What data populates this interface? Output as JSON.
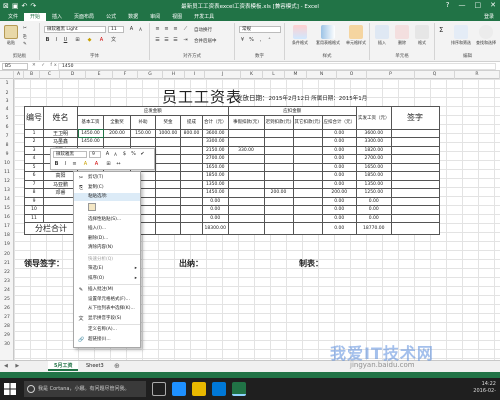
{
  "window": {
    "title": "最新员工工资表excel工资表模板.xls [兼容模式] - Excel",
    "controls": [
      "?",
      "—",
      "□",
      "✕"
    ]
  },
  "ribbon_tabs": [
    "文件",
    "开始",
    "插入",
    "页面布局",
    "公式",
    "数据",
    "审阅",
    "视图",
    "开发工具"
  ],
  "account": "登录",
  "ribbon": {
    "clipboard": {
      "label": "剪贴板",
      "paste": "粘贴",
      "cut": "✂",
      "copy": "⎘",
      "format_painter": "✎"
    },
    "font": {
      "label": "字体",
      "name": "微软雅黑 Light",
      "size": "11"
    },
    "alignment": {
      "label": "对齐方式",
      "wrap": "自动换行",
      "merge": "合并后居中"
    },
    "number": {
      "label": "数字",
      "format": "常规"
    },
    "styles": {
      "label": "样式",
      "conditional": "条件格式",
      "table": "套用表格格式",
      "cell_styles": "单元格样式"
    },
    "cells": {
      "label": "单元格",
      "insert": "插入",
      "delete": "删除",
      "format": "格式"
    },
    "editing": {
      "label": "编辑",
      "autosum": "Σ",
      "sort": "排序和筛选",
      "find": "查找和选择"
    }
  },
  "formula_bar": {
    "name_box": "B5",
    "fx": "✕ ✓ fx",
    "value": "1450"
  },
  "columns": [
    "A",
    "B",
    "C",
    "D",
    "E",
    "F",
    "G",
    "H",
    "I",
    "J",
    "K",
    "L",
    "M",
    "N",
    "O",
    "P",
    "Q",
    "R"
  ],
  "rows": [
    "1",
    "2",
    "3",
    "4",
    "5",
    "6",
    "7",
    "8",
    "9",
    "10",
    "11",
    "12",
    "13",
    "14",
    "15",
    "16",
    "17",
    "18",
    "19",
    "20",
    "21",
    "22",
    "23",
    "24",
    "25",
    "26",
    "27",
    "28",
    "29",
    "30"
  ],
  "sheet": {
    "title": "员工工资表",
    "issue_label": "发放日期：",
    "issue_value": "2015年2月12日  所属日期：2015年1月",
    "headers": {
      "no": "编号",
      "name": "姓名",
      "payable": "应发金额",
      "deduct": "应扣金额",
      "actual": "实发工资（元）",
      "sign": "签字",
      "sub_payable": [
        "基本工资",
        "全勤奖",
        "补助",
        "奖金",
        "提成",
        "合计（元）"
      ],
      "sub_deduct": [
        "事假扣款(元)",
        "迟到扣款(元)",
        "其它扣款(元)",
        "应扣合计（元）"
      ]
    },
    "rows": [
      {
        "no": "1",
        "name": "王卫明",
        "base": "1450.00",
        "attend": "200.00",
        "allow": "150.00",
        "bonus": "1000.00",
        "comm": "800.00",
        "total": "3600.00",
        "leave": "",
        "late": "",
        "other": "",
        "dtotal": "0.00",
        "net": "3600.00"
      },
      {
        "no": "2",
        "name": "马虽鑫",
        "base": "1450.00",
        "attend": "",
        "allow": "",
        "bonus": "",
        "comm": "",
        "total": "3300.00",
        "leave": "",
        "late": "",
        "other": "",
        "dtotal": "0.00",
        "net": "3300.00"
      },
      {
        "no": "3",
        "name": "郑国珣",
        "base": "",
        "attend": "",
        "allow": "",
        "bonus": "",
        "comm": "",
        "total": "2150.00",
        "leave": "330.00",
        "late": "",
        "other": "",
        "dtotal": "0.00",
        "net": "1820.00"
      },
      {
        "no": "4",
        "name": "马念佳",
        "base": "1450.00",
        "attend": "",
        "allow": "",
        "bonus": "",
        "comm": "",
        "total": "2700.00",
        "leave": "",
        "late": "",
        "other": "",
        "dtotal": "0.00",
        "net": "2700.00"
      },
      {
        "no": "5",
        "name": "张爱琴",
        "base": "",
        "attend": "",
        "allow": "",
        "bonus": "",
        "comm": "",
        "total": "1650.00",
        "leave": "",
        "late": "",
        "other": "",
        "dtotal": "0.00",
        "net": "1650.00"
      },
      {
        "no": "6",
        "name": "高阳",
        "base": "",
        "attend": "",
        "allow": "",
        "bonus": "",
        "comm": "",
        "total": "1850.00",
        "leave": "",
        "late": "",
        "other": "",
        "dtotal": "0.00",
        "net": "1850.00"
      },
      {
        "no": "7",
        "name": "马亚鹏",
        "base": "",
        "attend": "",
        "allow": "",
        "bonus": "",
        "comm": "",
        "total": "1350.00",
        "leave": "",
        "late": "",
        "other": "",
        "dtotal": "0.00",
        "net": "1350.00"
      },
      {
        "no": "8",
        "name": "邓睿",
        "base": "1450.00",
        "attend": "",
        "allow": "",
        "bonus": "",
        "comm": "",
        "total": "1450.00",
        "leave": "",
        "late": "200.00",
        "other": "",
        "dtotal": "200.00",
        "net": "1250.00"
      },
      {
        "no": "9",
        "name": "",
        "base": "",
        "attend": "",
        "allow": "",
        "bonus": "",
        "comm": "",
        "total": "0.00",
        "leave": "",
        "late": "",
        "other": "",
        "dtotal": "0.00",
        "net": "0.00"
      },
      {
        "no": "10",
        "name": "",
        "base": "",
        "attend": "",
        "allow": "",
        "bonus": "",
        "comm": "",
        "total": "0.00",
        "leave": "",
        "late": "",
        "other": "",
        "dtotal": "0.00",
        "net": "0.00"
      },
      {
        "no": "11",
        "name": "",
        "base": "",
        "attend": "",
        "allow": "",
        "bonus": "",
        "comm": "",
        "total": "0.00",
        "leave": "",
        "late": "",
        "other": "",
        "dtotal": "0.00",
        "net": "0.00"
      }
    ],
    "subtotal": {
      "label": "分栏合计",
      "total": "18300.00",
      "dtotal": "0.00",
      "net": "18770.00"
    },
    "signoff": [
      "领导签字：",
      "出纳：",
      "制表："
    ]
  },
  "mini_toolbar": {
    "font": "微软雅黑",
    "size": "9",
    "row2": [
      "B",
      "I",
      "≡",
      "A",
      "A",
      "⊞",
      "↔"
    ],
    "row1_btns": [
      "A",
      "A",
      "$",
      "%",
      "✔"
    ]
  },
  "context_menu": {
    "items": [
      {
        "icon": "✂",
        "label": "剪切(T)",
        "disabled": false
      },
      {
        "icon": "⎘",
        "label": "复制(C)",
        "disabled": false
      },
      {
        "icon": "",
        "label": "粘贴选项:",
        "disabled": false,
        "highlight": true
      },
      {
        "icon": "",
        "label": "",
        "disabled": false,
        "paste_icons": true
      },
      {
        "icon": "",
        "label": "选择性粘贴(S)...",
        "disabled": false
      },
      {
        "icon": "",
        "label": "插入(I)...",
        "disabled": false
      },
      {
        "icon": "",
        "label": "删除(D)...",
        "disabled": false
      },
      {
        "icon": "",
        "label": "清除内容(N)",
        "disabled": false
      },
      {
        "icon": "",
        "label": "快速分析(Q)",
        "disabled": true
      },
      {
        "icon": "",
        "label": "筛选(E)",
        "disabled": false,
        "arrow": true
      },
      {
        "icon": "",
        "label": "排序(O)",
        "disabled": false,
        "arrow": true
      },
      {
        "icon": "✎",
        "label": "插入批注(M)",
        "disabled": false
      },
      {
        "icon": "",
        "label": "设置单元格格式(F)...",
        "disabled": false
      },
      {
        "icon": "",
        "label": "从下拉列表中选择(K)...",
        "disabled": false
      },
      {
        "icon": "文",
        "label": "显示拼音字段(S)",
        "disabled": false
      },
      {
        "icon": "",
        "label": "定义名称(A)...",
        "disabled": false
      },
      {
        "icon": "🔗",
        "label": "超链接(I)...",
        "disabled": false
      }
    ]
  },
  "sheet_tabs": [
    "5月工资",
    "Sheet3"
  ],
  "taskbar": {
    "search_placeholder": "我是 Cortana，小娜。有问题尽管问我。",
    "time": "14:22",
    "date": "2016-02-"
  },
  "watermark": {
    "text": "我爱IT技术网",
    "url": "jingyan.baidu.com"
  }
}
